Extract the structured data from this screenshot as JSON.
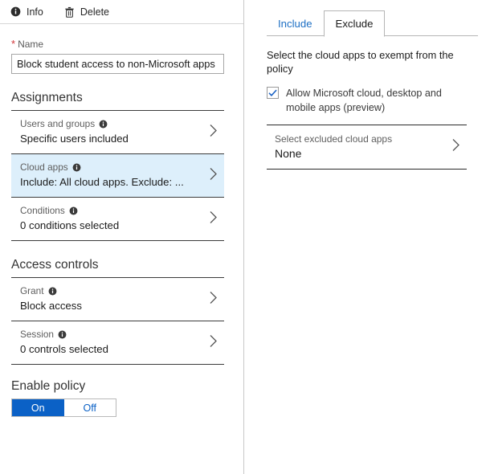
{
  "toolbar": {
    "items": [
      {
        "label": "Info",
        "icon": "info-icon"
      },
      {
        "label": "Delete",
        "icon": "trash-icon"
      }
    ]
  },
  "left_pane": {
    "name_field": {
      "label": "Name",
      "required_marker": "*",
      "value": "Block student access to non-Microsoft apps",
      "placeholder": "Name"
    },
    "sections": [
      {
        "title": "Assignments",
        "rows": [
          {
            "title": "Users and groups",
            "value": "Specific users included",
            "info_icon": "info-icon",
            "chevron": "chevron-right-icon",
            "selected": false
          },
          {
            "title": "Cloud apps",
            "value": "Include: All cloud apps. Exclude: ...",
            "info_icon": "info-icon",
            "chevron": "chevron-right-icon",
            "selected": true
          },
          {
            "title": "Conditions",
            "value": "0 conditions selected",
            "info_icon": "info-icon",
            "chevron": "chevron-right-icon",
            "selected": false
          }
        ]
      },
      {
        "title": "Access controls",
        "rows": [
          {
            "title": "Grant",
            "value": "Block access",
            "info_icon": "info-icon",
            "chevron": "chevron-right-icon",
            "selected": false
          },
          {
            "title": "Session",
            "value": "0 controls selected",
            "info_icon": "info-icon",
            "chevron": "chevron-right-icon",
            "selected": false
          }
        ]
      }
    ],
    "enable_policy": {
      "label": "Enable policy",
      "on_label": "On",
      "off_label": "Off",
      "selected": "On"
    }
  },
  "right_pane": {
    "tabs": [
      {
        "label": "Include",
        "active": false
      },
      {
        "label": "Exclude",
        "active": true
      }
    ],
    "hint": "Select the cloud apps to exempt from the policy",
    "checkbox": {
      "label": "Allow Microsoft cloud, desktop and mobile apps (preview)",
      "checked": true,
      "icon": "checkmark-icon"
    },
    "row": {
      "title": "Select excluded cloud apps",
      "value": "None",
      "chevron": "chevron-right-icon"
    }
  },
  "colors": {
    "accent": "#0b61c6",
    "selected_row_bg": "#ddeffb",
    "required_star": "#d13438",
    "link": "#1d6fc4"
  }
}
